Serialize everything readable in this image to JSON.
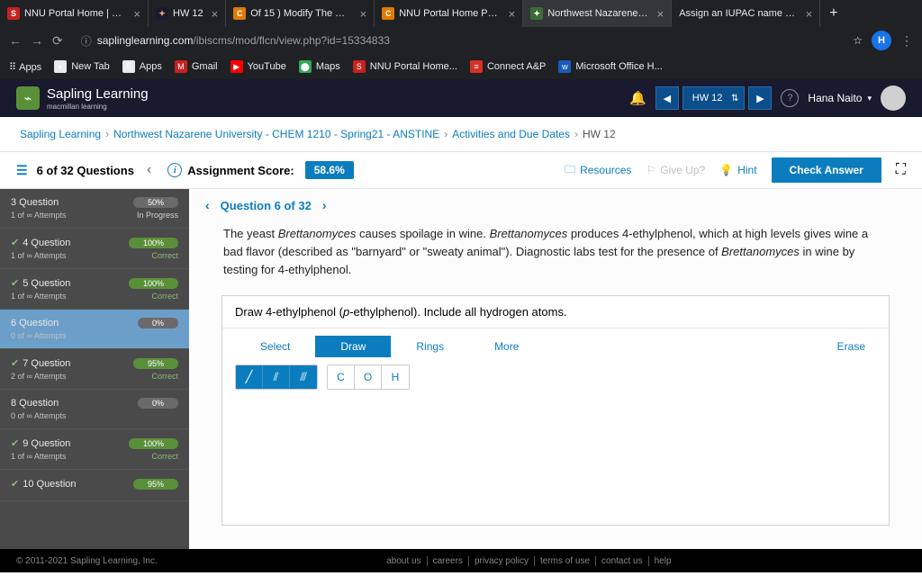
{
  "browser": {
    "tabs": [
      {
        "title": "NNU Portal Home | Portal",
        "fav": "fav-red",
        "favText": "S"
      },
      {
        "title": "HW 12",
        "fav": "fav-dark",
        "favText": "✦"
      },
      {
        "title": "Of 15 ) Modify The Molecu",
        "fav": "fav-orange",
        "favText": "C"
      },
      {
        "title": "NNU Portal Home Portal X",
        "fav": "fav-orange",
        "favText": "C"
      },
      {
        "title": "Northwest Nazarene Univer",
        "fav": "fav-green",
        "favText": "✦",
        "active": true
      },
      {
        "title": "Assign an IUPAC name to e",
        "fav": "",
        "favText": ""
      }
    ],
    "url_prefix": "saplinglearning.com",
    "url_path": "/ibiscms/mod/flcn/view.php?id=15334833",
    "profile": "H",
    "bookmarks": [
      {
        "label": "Apps",
        "icon": "⠿",
        "color": "#e8eaed"
      },
      {
        "label": "New Tab",
        "icon": "◐",
        "color": "#e8eaed"
      },
      {
        "label": "Apps",
        "icon": "⠿",
        "color": "#e8eaed"
      },
      {
        "label": "Gmail",
        "icon": "M",
        "color": "#c5221f"
      },
      {
        "label": "YouTube",
        "icon": "▶",
        "color": "#ff0000"
      },
      {
        "label": "Maps",
        "icon": "⬤",
        "color": "#34a853"
      },
      {
        "label": "NNU Portal Home...",
        "icon": "S",
        "color": "#c5221f"
      },
      {
        "label": "Connect A&P",
        "icon": "≡",
        "color": "#d93025"
      },
      {
        "label": "Microsoft Office H...",
        "icon": "w",
        "color": "#185abd"
      }
    ]
  },
  "header": {
    "brand": "Sapling Learning",
    "brand_sub": "macmillan learning",
    "hw_label": "HW 12",
    "user": "Hana Naito"
  },
  "breadcrumb": {
    "items": [
      "Sapling Learning",
      "Northwest Nazarene University - CHEM 1210 - Spring21 - ANSTINE",
      "Activities and Due Dates"
    ],
    "current": "HW 12"
  },
  "qbar": {
    "counter": "6 of 32 Questions",
    "score_label": "Assignment Score:",
    "score": "58.6%",
    "resources": "Resources",
    "giveup": "Give Up?",
    "hint": "Hint",
    "check": "Check Answer"
  },
  "sidebar": [
    {
      "title": "3 Question",
      "pill": "50%",
      "pillCls": "",
      "sub": "1 of ∞ Attempts",
      "status": "In Progress",
      "statusCls": "progress",
      "check": false
    },
    {
      "title": "4 Question",
      "pill": "100%",
      "pillCls": "green",
      "sub": "1 of ∞ Attempts",
      "status": "Correct",
      "statusCls": "correct",
      "check": true
    },
    {
      "title": "5 Question",
      "pill": "100%",
      "pillCls": "green",
      "sub": "1 of ∞ Attempts",
      "status": "Correct",
      "statusCls": "correct",
      "check": true
    },
    {
      "title": "6 Question",
      "pill": "0%",
      "pillCls": "",
      "sub": "0 of ∞ Attempts",
      "status": "",
      "statusCls": "",
      "check": false,
      "active": true
    },
    {
      "title": "7 Question",
      "pill": "95%",
      "pillCls": "green",
      "sub": "2 of ∞ Attempts",
      "status": "Correct",
      "statusCls": "correct",
      "check": true
    },
    {
      "title": "8 Question",
      "pill": "0%",
      "pillCls": "",
      "sub": "0 of ∞ Attempts",
      "status": "",
      "statusCls": "",
      "check": false
    },
    {
      "title": "9 Question",
      "pill": "100%",
      "pillCls": "green",
      "sub": "1 of ∞ Attempts",
      "status": "Correct",
      "statusCls": "correct",
      "check": true
    },
    {
      "title": "10 Question",
      "pill": "95%",
      "pillCls": "green",
      "sub": "",
      "status": "",
      "statusCls": "",
      "check": true
    }
  ],
  "qnav": {
    "label": "Question 6 of 32"
  },
  "problem": {
    "p1a": "The yeast ",
    "p1b": "Brettanomyces",
    "p1c": " causes spoilage in wine. ",
    "p1d": "Brettanomyces",
    "p1e": " produces 4-ethylphenol, which at high levels gives wine a bad flavor (described as \"barnyard\" or \"sweaty animal\"). Diagnostic labs test for the presence of ",
    "p1f": "Brettanomyces",
    "p1g": " in wine by testing for 4-ethylphenol."
  },
  "draw": {
    "prompt_a": "Draw 4-ethylphenol (",
    "prompt_b": "p",
    "prompt_c": "-ethylphenol). Include all hydrogen atoms.",
    "tabs": {
      "select": "Select",
      "draw": "Draw",
      "rings": "Rings",
      "more": "More"
    },
    "erase": "Erase",
    "atoms": {
      "c": "C",
      "o": "O",
      "h": "H"
    }
  },
  "footer": {
    "copyright": "© 2011-2021 Sapling Learning, Inc.",
    "links": [
      "about us",
      "careers",
      "privacy policy",
      "terms of use",
      "contact us",
      "help"
    ]
  }
}
